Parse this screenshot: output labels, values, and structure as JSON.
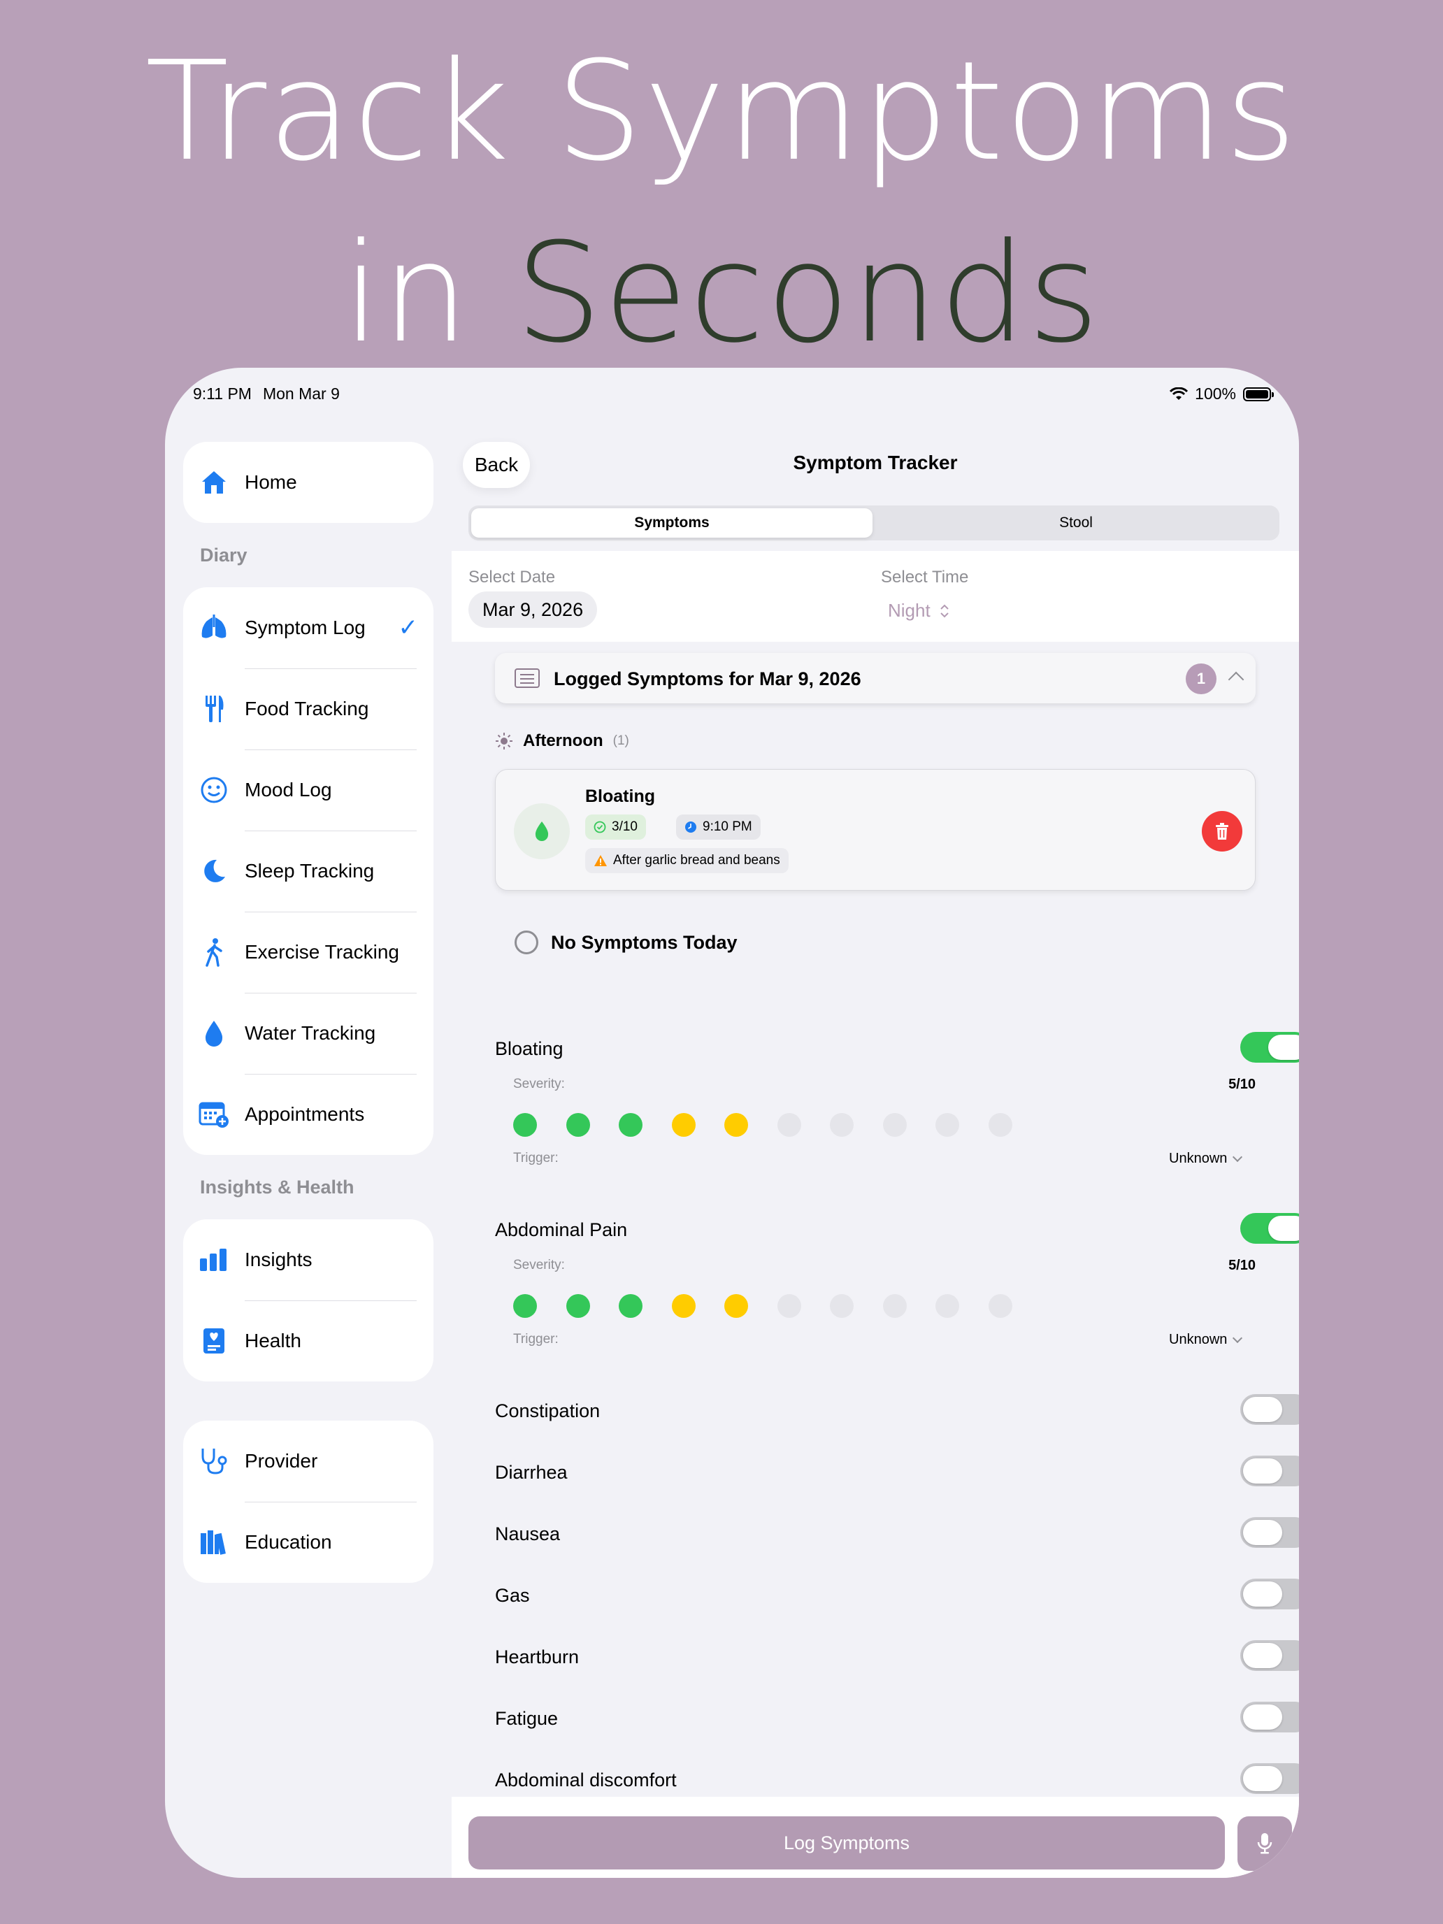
{
  "headline": {
    "line1": "Track Symptoms",
    "line2_a": "in ",
    "line2_b": "Seconds"
  },
  "status_bar": {
    "time": "9:11 PM",
    "date": "Mon Mar 9",
    "battery": "100%"
  },
  "sidebar": {
    "home": "Home",
    "diary_label": "Diary",
    "diary_items": [
      "Symptom Log",
      "Food Tracking",
      "Mood Log",
      "Sleep Tracking",
      "Exercise Tracking",
      "Water Tracking",
      "Appointments"
    ],
    "diary_selected": "✓",
    "insights_label": "Insights & Health",
    "insights_items": [
      "Insights",
      "Health"
    ],
    "other_items": [
      "Provider",
      "Education"
    ]
  },
  "nav": {
    "back": "Back",
    "title": "Symptom Tracker"
  },
  "segments": {
    "active": "Symptoms",
    "inactive": "Stool"
  },
  "date_picker": {
    "date_label": "Select Date",
    "date_value": "Mar 9, 2026",
    "time_label": "Select Time",
    "time_value": "Night"
  },
  "logged": {
    "title": "Logged Symptoms for Mar 9, 2026",
    "count": "1",
    "period": "Afternoon",
    "period_count": "(1)",
    "entry": {
      "name": "Bloating",
      "severity": "3/10",
      "time": "9:10 PM",
      "note": "After garlic bread and beans"
    }
  },
  "no_symptoms": "No Symptoms Today",
  "labels": {
    "severity": "Severity:",
    "trigger": "Trigger:"
  },
  "expanded_symptoms": [
    {
      "name": "Bloating",
      "on": true,
      "severity": "5/10",
      "level": 5,
      "trigger": "Unknown"
    },
    {
      "name": "Abdominal Pain",
      "on": true,
      "severity": "5/10",
      "level": 5,
      "trigger": "Unknown"
    }
  ],
  "other_symptoms": [
    "Constipation",
    "Diarrhea",
    "Nausea",
    "Gas",
    "Heartburn",
    "Fatigue",
    "Abdominal discomfort"
  ],
  "dot_colors": {
    "low": "#34c759",
    "mid": "#ffcc00",
    "empty": "#e5e5ea"
  },
  "actions": {
    "log": "Log Symptoms"
  },
  "colors": {
    "accent": "#1e7cf0",
    "brand": "#b39bb3",
    "toggle_on": "#34c759",
    "danger": "#f23a3a"
  }
}
